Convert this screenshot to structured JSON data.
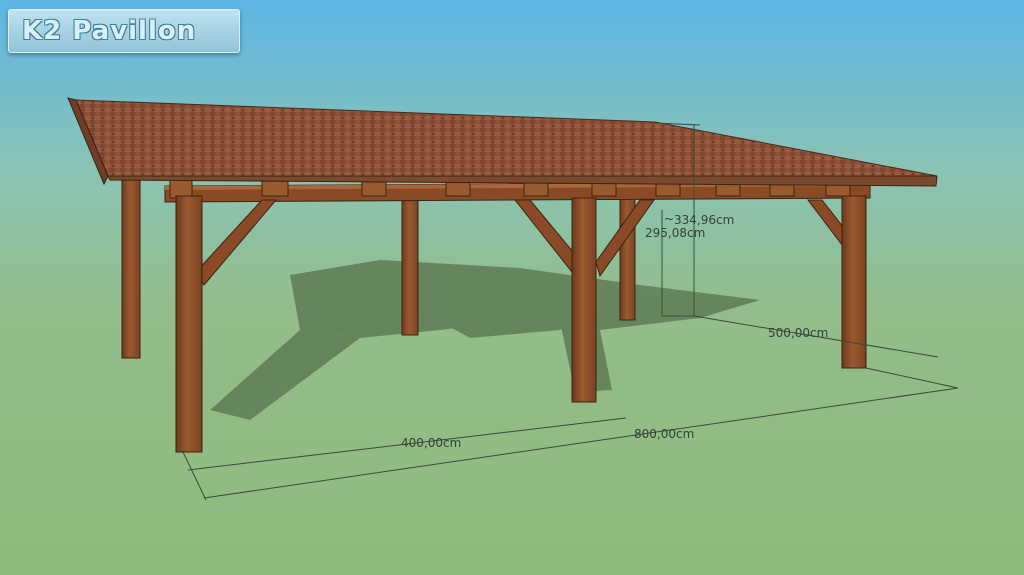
{
  "brand": {
    "title": "K2 Pavillon"
  },
  "dimensions": {
    "ridge_height": "334,96cm",
    "eave_height": "295,08cm",
    "depth": "500,00cm",
    "post_spacing": "400,00cm",
    "total_length": "800,00cm",
    "ridge_prefix": "~"
  },
  "colors": {
    "roof": "#8a5038",
    "timber": "#8a4a26",
    "shadow": "#5f7b55"
  }
}
